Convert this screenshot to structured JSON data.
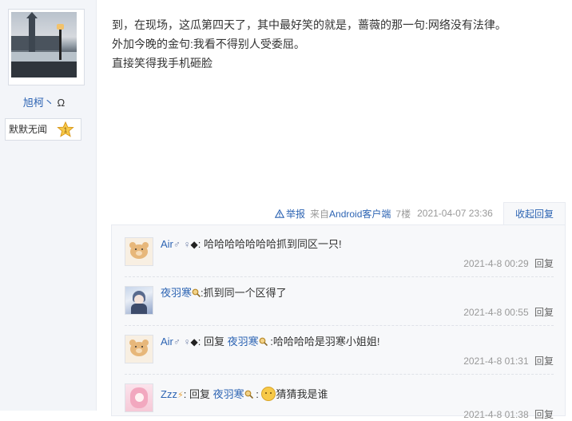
{
  "user": {
    "name": "旭柯丶",
    "name_symbol": "Ω",
    "badge_text": "默默无闻",
    "badge_level": "1"
  },
  "post": {
    "lines": [
      "到，在现场，这瓜第四天了，其中最好笑的就是，蔷薇的那一句:网络没有法律。",
      "外加今晚的金句:我看不得别人受委屈。",
      "直接笑得我手机砸脸"
    ],
    "report_label": "举报",
    "from_prefix": "来自",
    "from_client": "Android客户端",
    "floor": "7楼",
    "time": "2021-04-07 23:36",
    "collapse_label": "收起回复"
  },
  "comments": [
    {
      "name": "Air",
      "symbols": [
        "♂",
        "♀",
        "◆"
      ],
      "separator": ":",
      "text": "哈哈哈哈哈哈哈抓到同区一只!",
      "time": "2021-4-8 00:29",
      "reply_label": "回复"
    },
    {
      "name": "夜羽寒",
      "separator": ":",
      "text": "抓到同一个区得了",
      "time": "2021-4-8 00:55",
      "reply_label": "回复"
    },
    {
      "name": "Air",
      "symbols": [
        "♂",
        "♀",
        "◆"
      ],
      "separator": ":",
      "reply_word": "回复",
      "target": "夜羽寒",
      "text": ":哈哈哈哈是羽寒小姐姐!",
      "time": "2021-4-8 01:31",
      "reply_label": "回复"
    },
    {
      "name": "Zzz",
      "symbol": "⚡",
      "separator": ":",
      "reply_word": "回复",
      "target": "夜羽寒",
      "text": "猜猜我是谁",
      "time": "2021-4-8 01:38",
      "reply_label": "回复"
    }
  ],
  "colors": {
    "link": "#2d64b3",
    "muted": "#999999",
    "sidebar_bg": "#f3f5f9",
    "comments_bg": "#f7f8fa"
  }
}
